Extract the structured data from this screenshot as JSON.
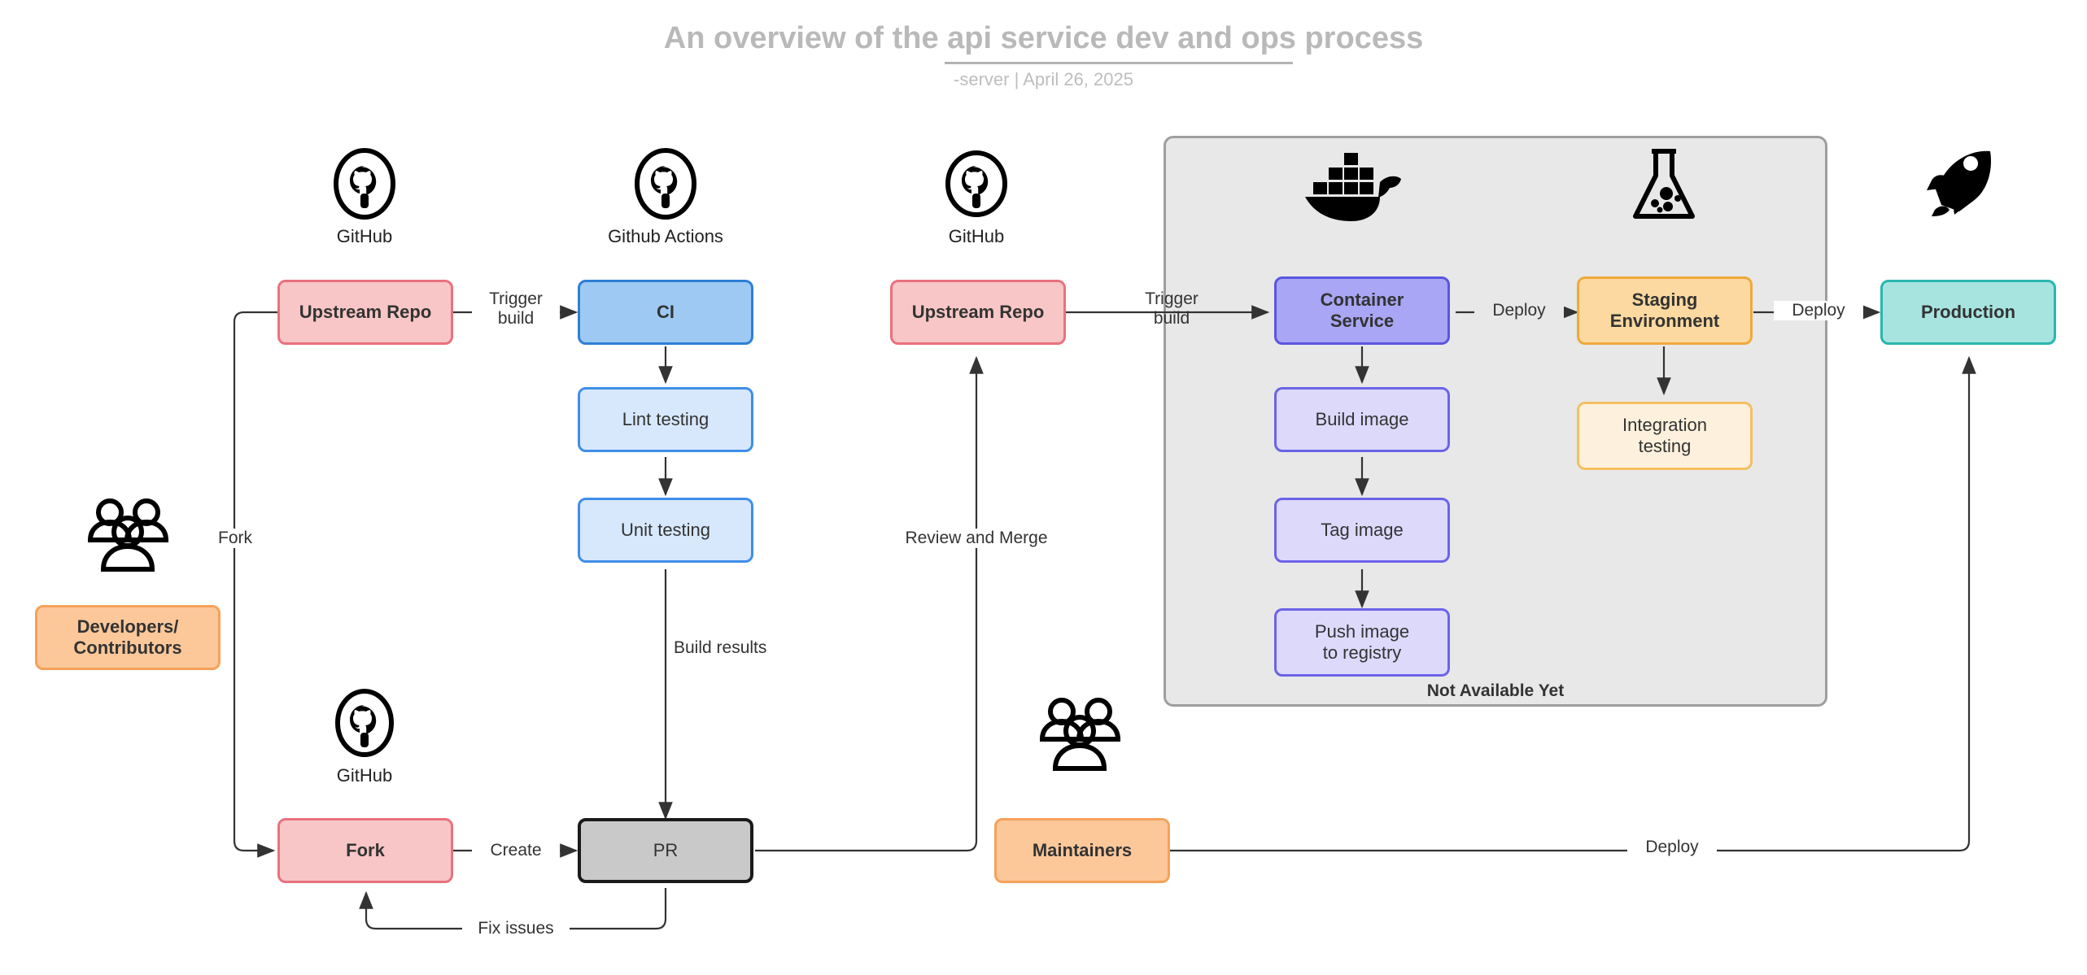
{
  "header": {
    "title": "An overview of the api service dev and ops process",
    "subtitle": "-server  |  April 26, 2025"
  },
  "icons": [
    {
      "name": "github-icon",
      "label": "GitHub"
    },
    {
      "name": "github-icon",
      "label": "Github Actions"
    },
    {
      "name": "github-icon",
      "label": "GitHub"
    },
    {
      "name": "docker-icon",
      "label": ""
    },
    {
      "name": "flask-icon",
      "label": ""
    },
    {
      "name": "rocket-icon",
      "label": ""
    },
    {
      "name": "people-icon",
      "label": ""
    },
    {
      "name": "github-icon",
      "label": "GitHub"
    },
    {
      "name": "people-icon",
      "label": ""
    }
  ],
  "nodes": {
    "upstream_repo_1": {
      "label": "Upstream Repo",
      "fill": "#f8c6c6",
      "stroke": "#e8727d"
    },
    "ci": {
      "label": "CI",
      "fill": "#9ec9f2",
      "stroke": "#2e7fd4"
    },
    "lint_testing": {
      "label": "Lint testing",
      "fill": "#d7e8fd",
      "stroke": "#3f8ee8"
    },
    "unit_testing": {
      "label": "Unit testing",
      "fill": "#d7e8fd",
      "stroke": "#3f8ee8"
    },
    "developers": {
      "label": "Developers/\nContributors",
      "fill": "#fcc89a",
      "stroke": "#f5a259"
    },
    "fork": {
      "label": "Fork",
      "fill": "#f8c6c6",
      "stroke": "#e8727d"
    },
    "pr": {
      "label": "PR",
      "fill": "#c9c9c9",
      "stroke": "#1a1a1a"
    },
    "maintainers": {
      "label": "Maintainers",
      "fill": "#fcc89a",
      "stroke": "#f5a259"
    },
    "upstream_repo_2": {
      "label": "Upstream Repo",
      "fill": "#f8c6c6",
      "stroke": "#e8727d"
    },
    "container_service": {
      "label": "Container\nService",
      "fill": "#a9a6f5",
      "stroke": "#5b55e0"
    },
    "build_image": {
      "label": "Build image",
      "fill": "#dcd9fb",
      "stroke": "#6c63e8"
    },
    "tag_image": {
      "label": "Tag image",
      "fill": "#dcd9fb",
      "stroke": "#6c63e8"
    },
    "push_image": {
      "label": "Push image\nto registry",
      "fill": "#dcd9fb",
      "stroke": "#6c63e8"
    },
    "staging_env": {
      "label": "Staging\nEnvironment",
      "fill": "#fcd9a0",
      "stroke": "#f0a93c"
    },
    "integration_test": {
      "label": "Integration\ntesting",
      "fill": "#fdf1dd",
      "stroke": "#f5bf62"
    },
    "production": {
      "label": "Production",
      "fill": "#a7e4e0",
      "stroke": "#29b6ad"
    }
  },
  "group": {
    "label": "Not Available Yet",
    "fill": "#e8e8e8",
    "stroke": "#9e9e9e"
  },
  "edge_labels": {
    "trigger_build_1": "Trigger\nbuild",
    "fork": "Fork",
    "build_results": "Build results",
    "create": "Create",
    "fix_issues": "Fix issues",
    "review_and_merge": "Review and Merge",
    "trigger_build_2": "Trigger\nbuild",
    "deploy_1": "Deploy",
    "deploy_2": "Deploy",
    "deploy_3": "Deploy"
  }
}
